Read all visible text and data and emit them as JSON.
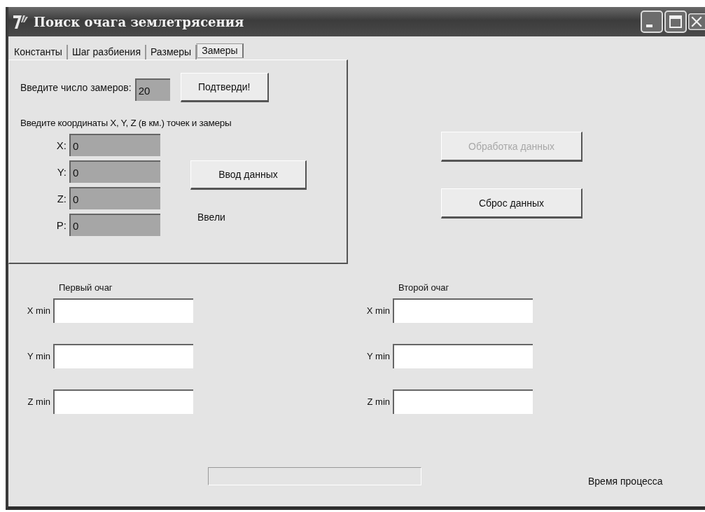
{
  "window": {
    "title": "Поиск очага землетрясения"
  },
  "tabs": [
    {
      "label": "Константы",
      "selected": false
    },
    {
      "label": "Шаг разбиения",
      "selected": false
    },
    {
      "label": "Размеры",
      "selected": false
    },
    {
      "label": "Замеры",
      "selected": true
    }
  ],
  "measurements": {
    "count_label": "Введите число замеров:",
    "count_value": "20",
    "confirm_button": "Подтверди!",
    "coords_label": "Введите координаты X, Y, Z (в км.) точек и замеры",
    "coords": [
      {
        "label": "X:",
        "value": "0"
      },
      {
        "label": "Y:",
        "value": "0"
      },
      {
        "label": "Z:",
        "value": "0"
      },
      {
        "label": "P:",
        "value": "0"
      }
    ],
    "enter_button": "Ввод данных",
    "status": "Ввели"
  },
  "actions": [
    {
      "label": "Обработка данных",
      "disabled": true
    },
    {
      "label": "Сброс данных",
      "disabled": false
    }
  ],
  "foci": [
    {
      "title": "Первый очаг",
      "fields": [
        {
          "label": "X min"
        },
        {
          "label": "Y min"
        },
        {
          "label": "Z min"
        }
      ]
    },
    {
      "title": "Второй очаг",
      "fields": [
        {
          "label": "X min"
        },
        {
          "label": "Y min"
        },
        {
          "label": "Z min"
        }
      ]
    }
  ],
  "progress": {
    "level": 0
  },
  "process_time_label": "Время процесса"
}
